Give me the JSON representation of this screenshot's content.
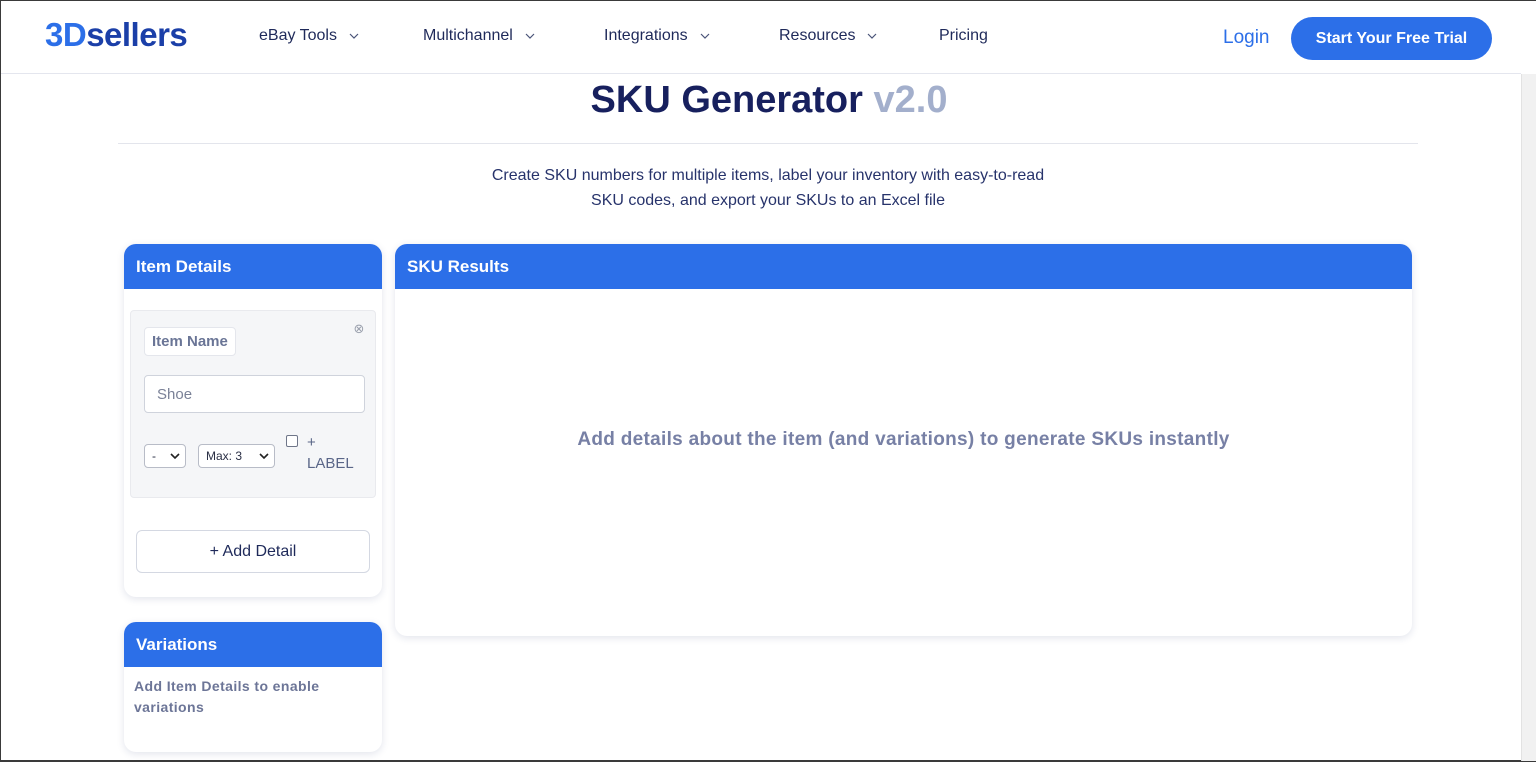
{
  "header": {
    "logo_prefix": "3D",
    "logo_suffix": "sellers",
    "nav": [
      {
        "label": "eBay Tools",
        "has_dropdown": true
      },
      {
        "label": "Multichannel",
        "has_dropdown": true
      },
      {
        "label": "Integrations",
        "has_dropdown": true
      },
      {
        "label": "Resources",
        "has_dropdown": true
      },
      {
        "label": "Pricing",
        "has_dropdown": false
      }
    ],
    "login_label": "Login",
    "cta_label": "Start Your Free Trial"
  },
  "page": {
    "title": "SKU Generator",
    "version": "v2.0",
    "intro_line1": "Create SKU numbers for multiple items, label your inventory with easy-to-read",
    "intro_line2": "SKU codes, and export your SKUs to an Excel file"
  },
  "item_details": {
    "heading": "Item Details",
    "detail": {
      "name_label": "Item Name",
      "name_value": "Shoe",
      "separator_value": "-",
      "max_value": "Max: 3",
      "label_checked": false,
      "label_text_plus": "+",
      "label_text": "LABEL"
    },
    "add_detail_label": "+ Add Detail"
  },
  "sku_results": {
    "heading": "SKU Results",
    "empty_message": "Add details about the item (and variations) to generate SKUs instantly"
  },
  "variations": {
    "heading": "Variations",
    "message": "Add Item Details to enable variations"
  },
  "colors": {
    "primary": "#2c6fe8",
    "title_dark": "#17205e",
    "version_gray": "#a3afcc"
  }
}
